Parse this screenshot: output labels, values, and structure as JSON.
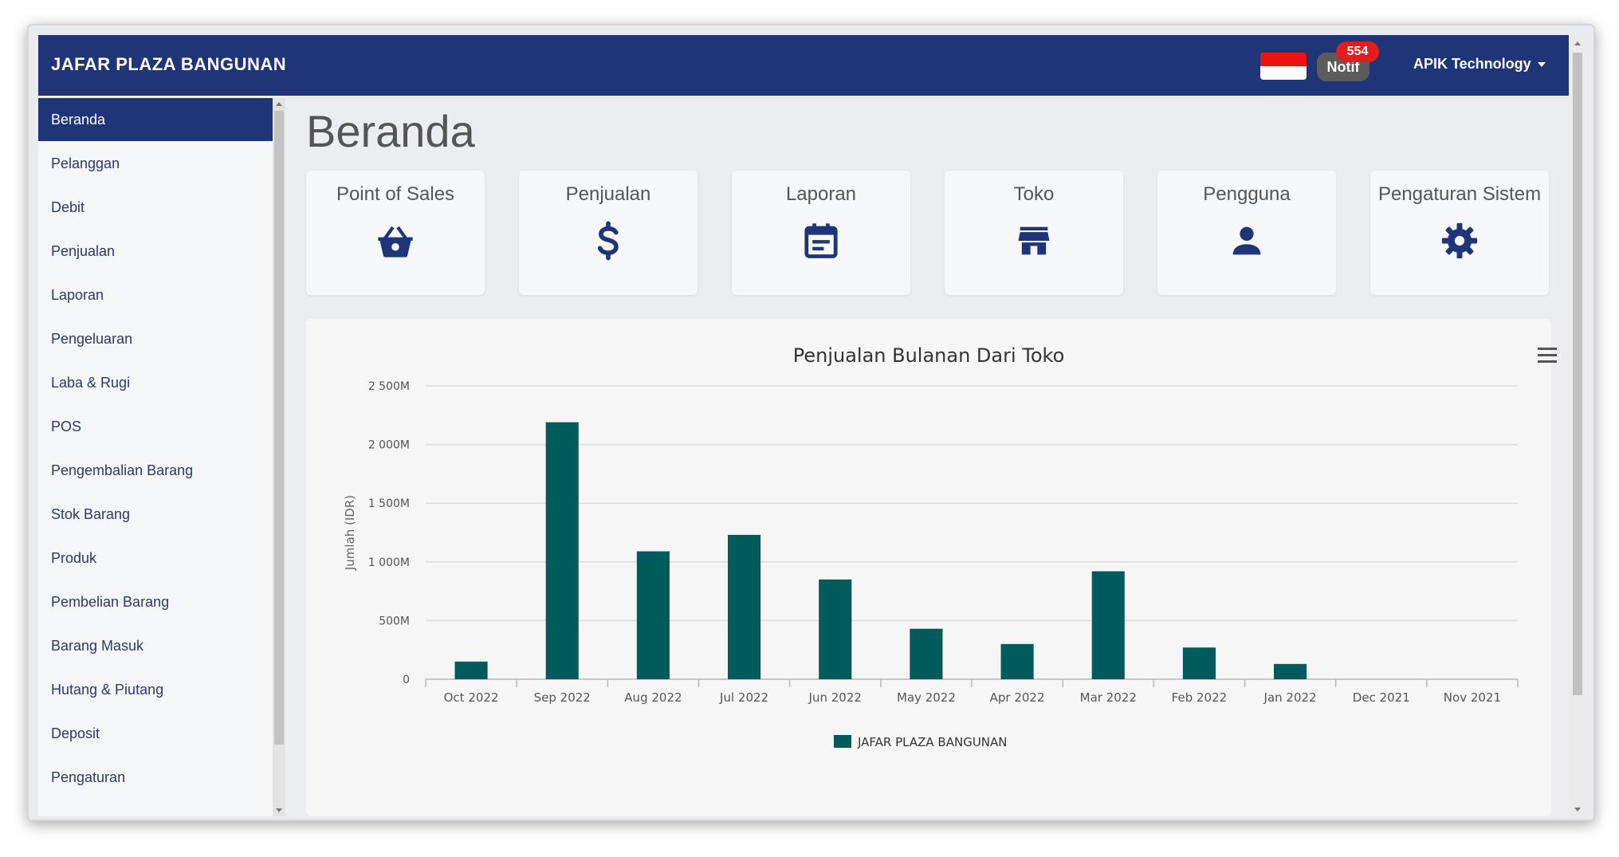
{
  "header": {
    "brand": "JAFAR PLAZA BANGUNAN",
    "notif_label": "Notif",
    "notif_count": "554",
    "user_menu": "APIK Technology"
  },
  "sidebar": {
    "items": [
      {
        "label": "Beranda",
        "active": true
      },
      {
        "label": "Pelanggan"
      },
      {
        "label": "Debit"
      },
      {
        "label": "Penjualan"
      },
      {
        "label": "Laporan"
      },
      {
        "label": "Pengeluaran"
      },
      {
        "label": "Laba & Rugi"
      },
      {
        "label": "POS"
      },
      {
        "label": "Pengembalian Barang"
      },
      {
        "label": "Stok Barang"
      },
      {
        "label": "Produk"
      },
      {
        "label": "Pembelian Barang"
      },
      {
        "label": "Barang Masuk"
      },
      {
        "label": "Hutang & Piutang"
      },
      {
        "label": "Deposit"
      },
      {
        "label": "Pengaturan"
      }
    ]
  },
  "page": {
    "title": "Beranda"
  },
  "cards": [
    {
      "label": "Point of Sales",
      "icon": "basket-icon"
    },
    {
      "label": "Penjualan",
      "icon": "dollar-icon"
    },
    {
      "label": "Laporan",
      "icon": "calendar-icon"
    },
    {
      "label": "Toko",
      "icon": "store-icon"
    },
    {
      "label": "Pengguna",
      "icon": "person-icon"
    },
    {
      "label": "Pengaturan Sistem",
      "icon": "gear-icon"
    }
  ],
  "colors": {
    "header_bg": "#1f3577",
    "accent": "#1f3577",
    "bar": "#005b5c",
    "notif_badge": "#e01e1e"
  },
  "chart_data": {
    "type": "bar",
    "title": "Penjualan Bulanan Dari Toko",
    "xlabel": "",
    "ylabel": "Jumlah (IDR)",
    "categories": [
      "Oct 2022",
      "Sep 2022",
      "Aug 2022",
      "Jul 2022",
      "Jun 2022",
      "May 2022",
      "Apr 2022",
      "Mar 2022",
      "Feb 2022",
      "Jan 2022",
      "Dec 2021",
      "Nov 2021"
    ],
    "series": [
      {
        "name": "JAFAR PLAZA BANGUNAN",
        "values": [
          150,
          2190,
          1090,
          1230,
          850,
          430,
          300,
          920,
          270,
          130,
          0,
          0
        ]
      }
    ],
    "value_unit": "M",
    "ylim": [
      0,
      2500
    ],
    "yticks": [
      {
        "value": 0,
        "label": "0"
      },
      {
        "value": 500,
        "label": "500M"
      },
      {
        "value": 1000,
        "label": "1 000M"
      },
      {
        "value": 1500,
        "label": "1 500M"
      },
      {
        "value": 2000,
        "label": "2 000M"
      },
      {
        "value": 2500,
        "label": "2 500M"
      }
    ],
    "grid": true,
    "legend": "bottom-center"
  }
}
